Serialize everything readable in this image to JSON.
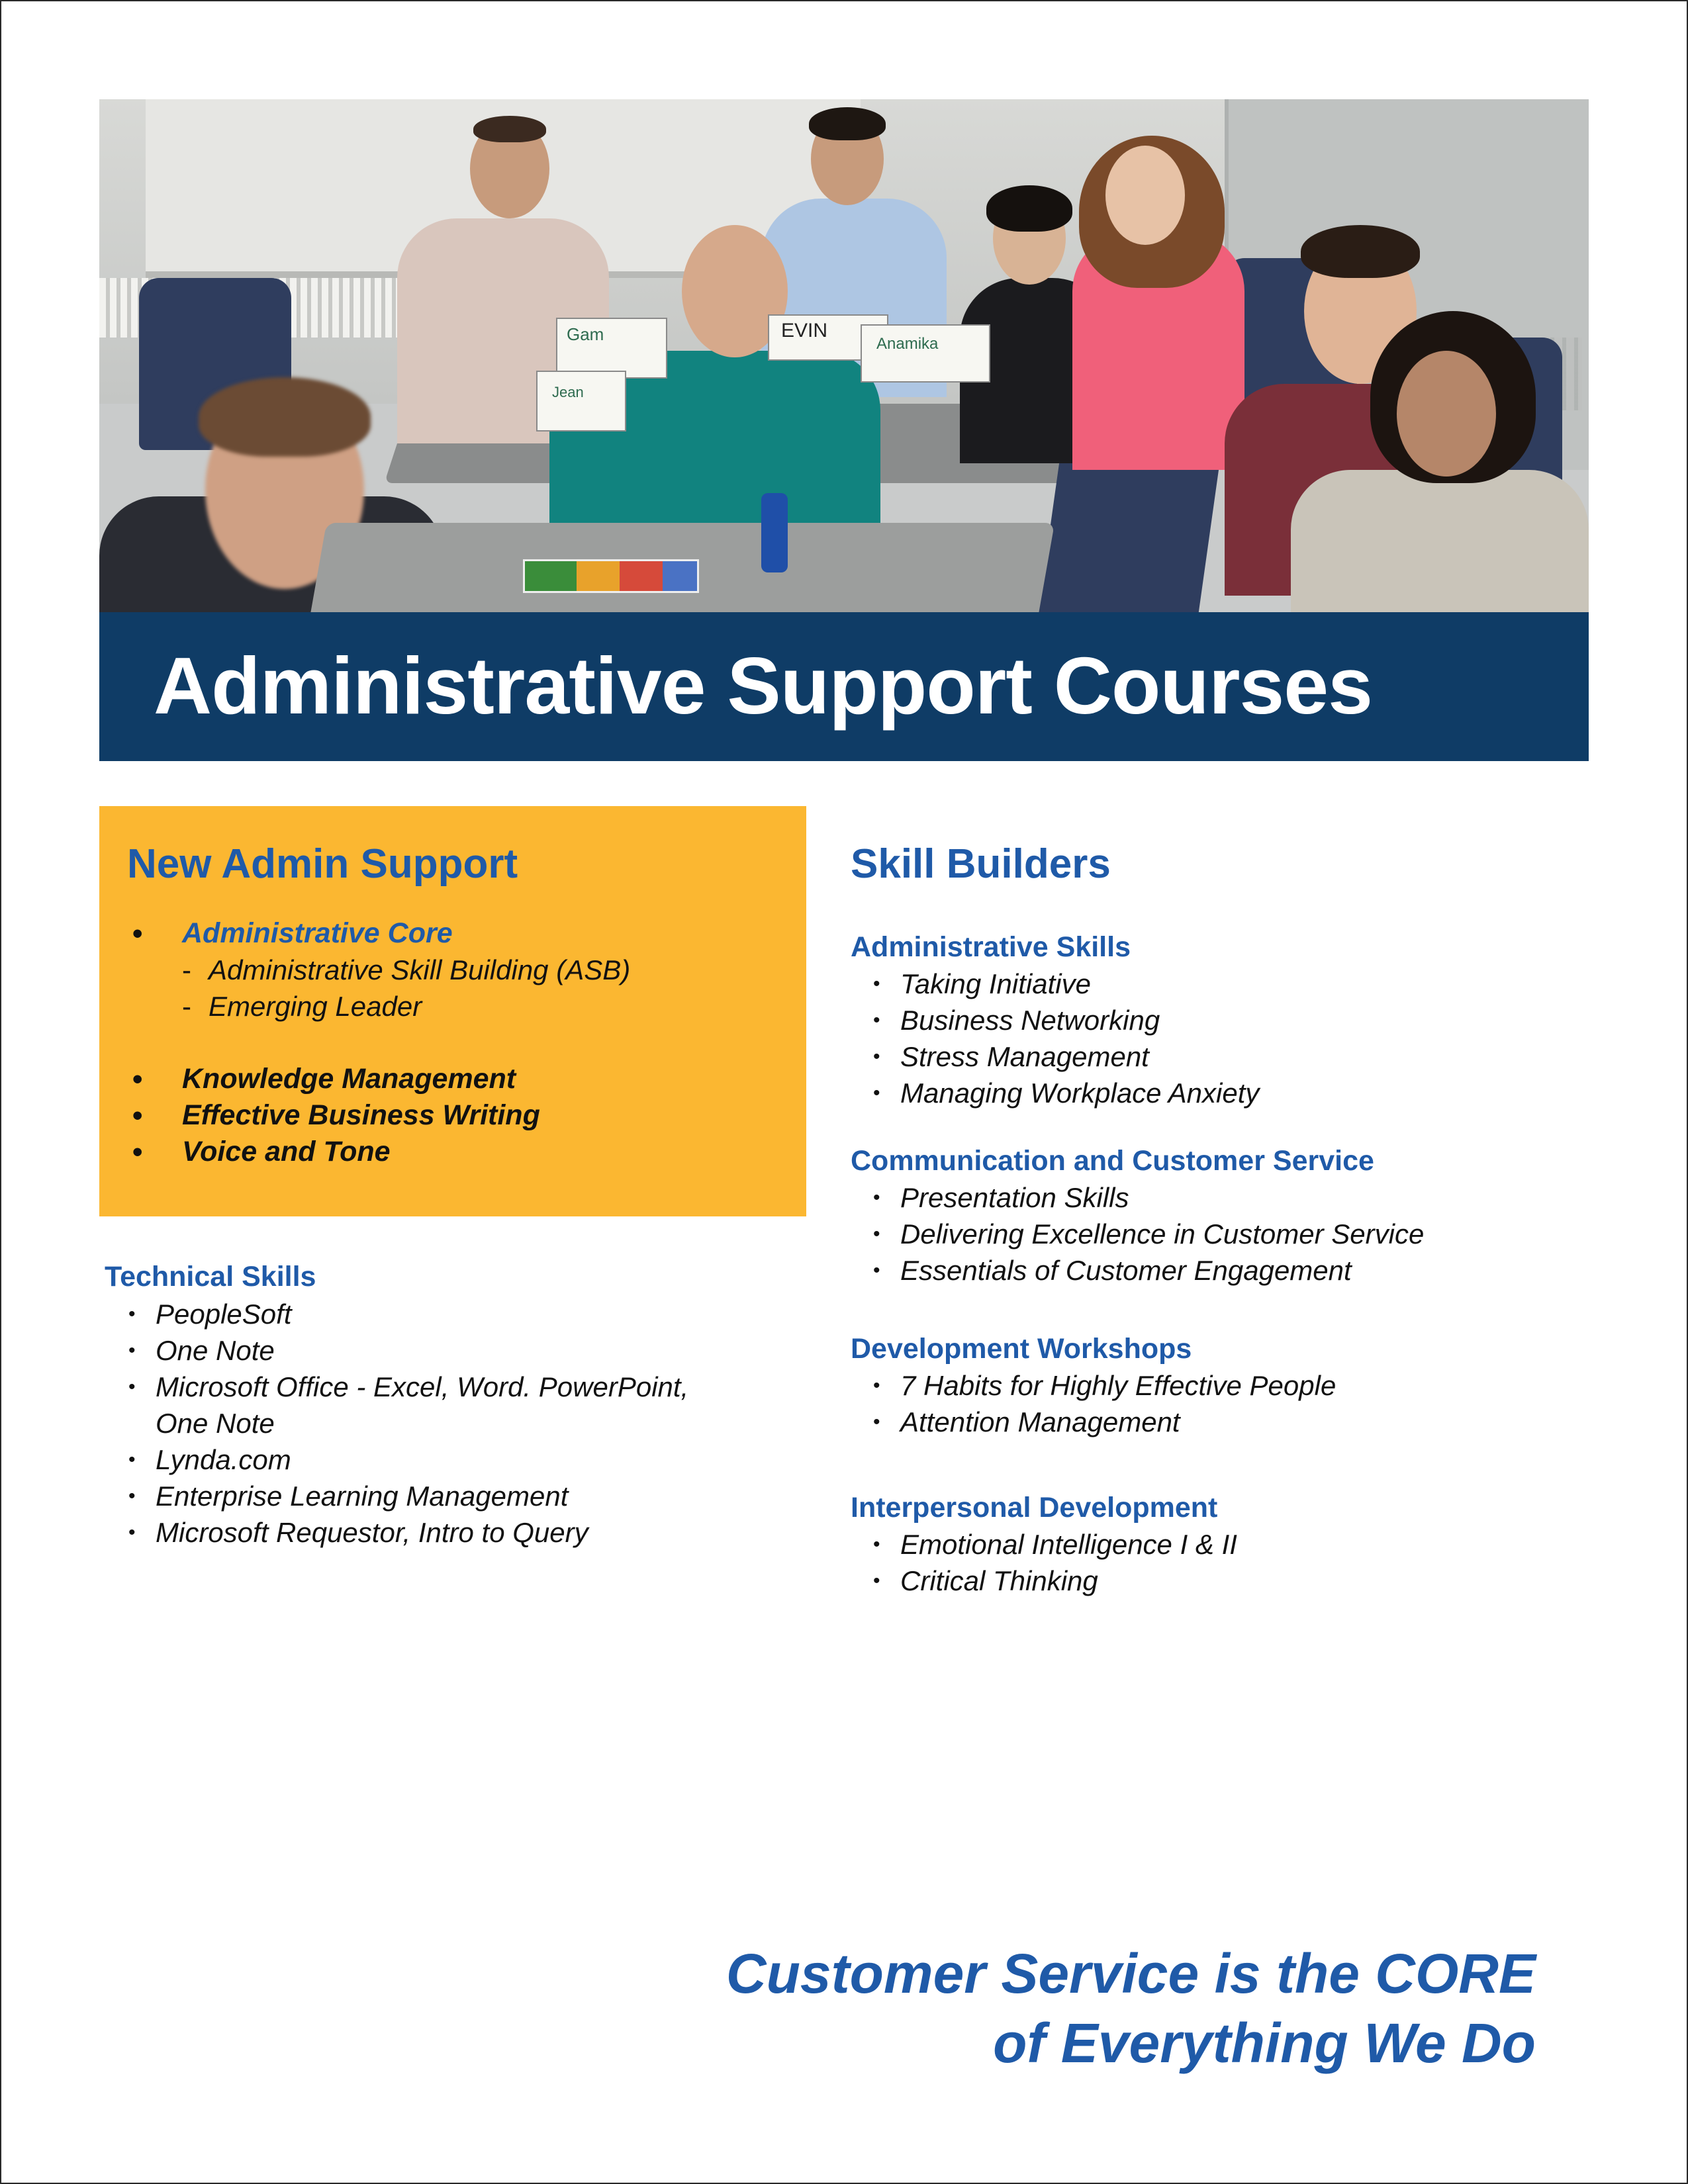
{
  "header": {
    "title": "Administrative Support Courses",
    "photo_card_labels": [
      "Gam",
      "EVIN",
      "Anamika",
      "Jean"
    ]
  },
  "new_admin": {
    "heading": "New Admin Support",
    "core": {
      "label": "Administrative Core",
      "sub_items": [
        "Administrative Skill Building (ASB)",
        "Emerging Leader"
      ]
    },
    "items": [
      "Knowledge Management",
      "Effective Business Writing",
      "Voice and Tone"
    ]
  },
  "technical": {
    "heading": "Technical Skills",
    "items": [
      "PeopleSoft",
      "One Note",
      "Microsoft Office - Excel, Word. PowerPoint,",
      "Lynda.com",
      "Enterprise Learning Management",
      "Microsoft Requestor, Intro to Query"
    ],
    "continuation": "One Note"
  },
  "skill_builders": {
    "heading": "Skill Builders",
    "groups": [
      {
        "title": "Administrative Skills",
        "items": [
          "Taking Initiative",
          "Business Networking",
          "Stress Management",
          "Managing Workplace Anxiety"
        ]
      },
      {
        "title": "Communication and Customer Service",
        "items": [
          "Presentation Skills",
          "Delivering Excellence in Customer Service",
          "Essentials of Customer Engagement"
        ]
      },
      {
        "title": "Development Workshops",
        "items": [
          "7 Habits for Highly Effective People",
          "Attention Management"
        ]
      },
      {
        "title": "Interpersonal Development",
        "items": [
          "Emotional Intelligence I & II",
          "Critical Thinking"
        ]
      }
    ]
  },
  "tagline": {
    "line1": "Customer Service is the CORE",
    "line2": "of Everything We Do"
  },
  "colors": {
    "navy_banner": "#0f3c66",
    "accent_blue": "#1f5aa8",
    "yellow_box": "#fbb731"
  }
}
